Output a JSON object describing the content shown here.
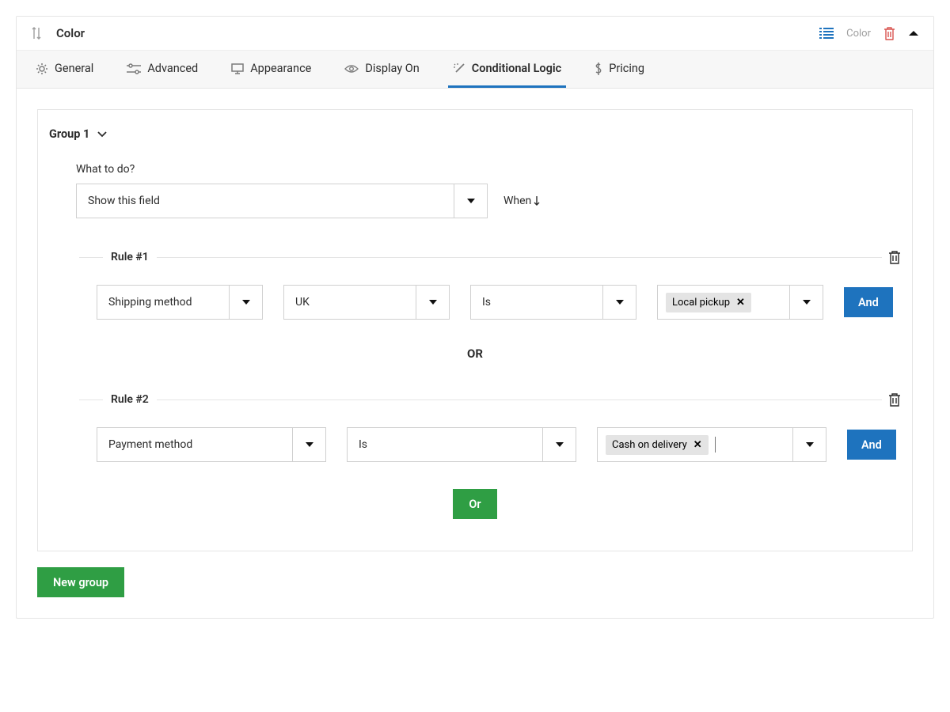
{
  "header": {
    "title": "Color",
    "chip_label": "Color"
  },
  "tabs": [
    {
      "label": "General"
    },
    {
      "label": "Advanced"
    },
    {
      "label": "Appearance"
    },
    {
      "label": "Display On"
    },
    {
      "label": "Conditional Logic",
      "active": true
    },
    {
      "label": "Pricing"
    }
  ],
  "group": {
    "title": "Group 1",
    "what_to_do_label": "What to do?",
    "what_to_do_value": "Show this field",
    "when_label": "When",
    "rules": {
      "r1": {
        "title": "Rule #1",
        "field": "Shipping method",
        "zone": "UK",
        "op": "Is",
        "tag": "Local pickup",
        "and": "And"
      },
      "or_text": "OR",
      "r2": {
        "title": "Rule #2",
        "field": "Payment method",
        "op": "Is",
        "tag": "Cash on delivery",
        "and": "And"
      },
      "or_button": "Or"
    }
  },
  "new_group_label": "New group"
}
